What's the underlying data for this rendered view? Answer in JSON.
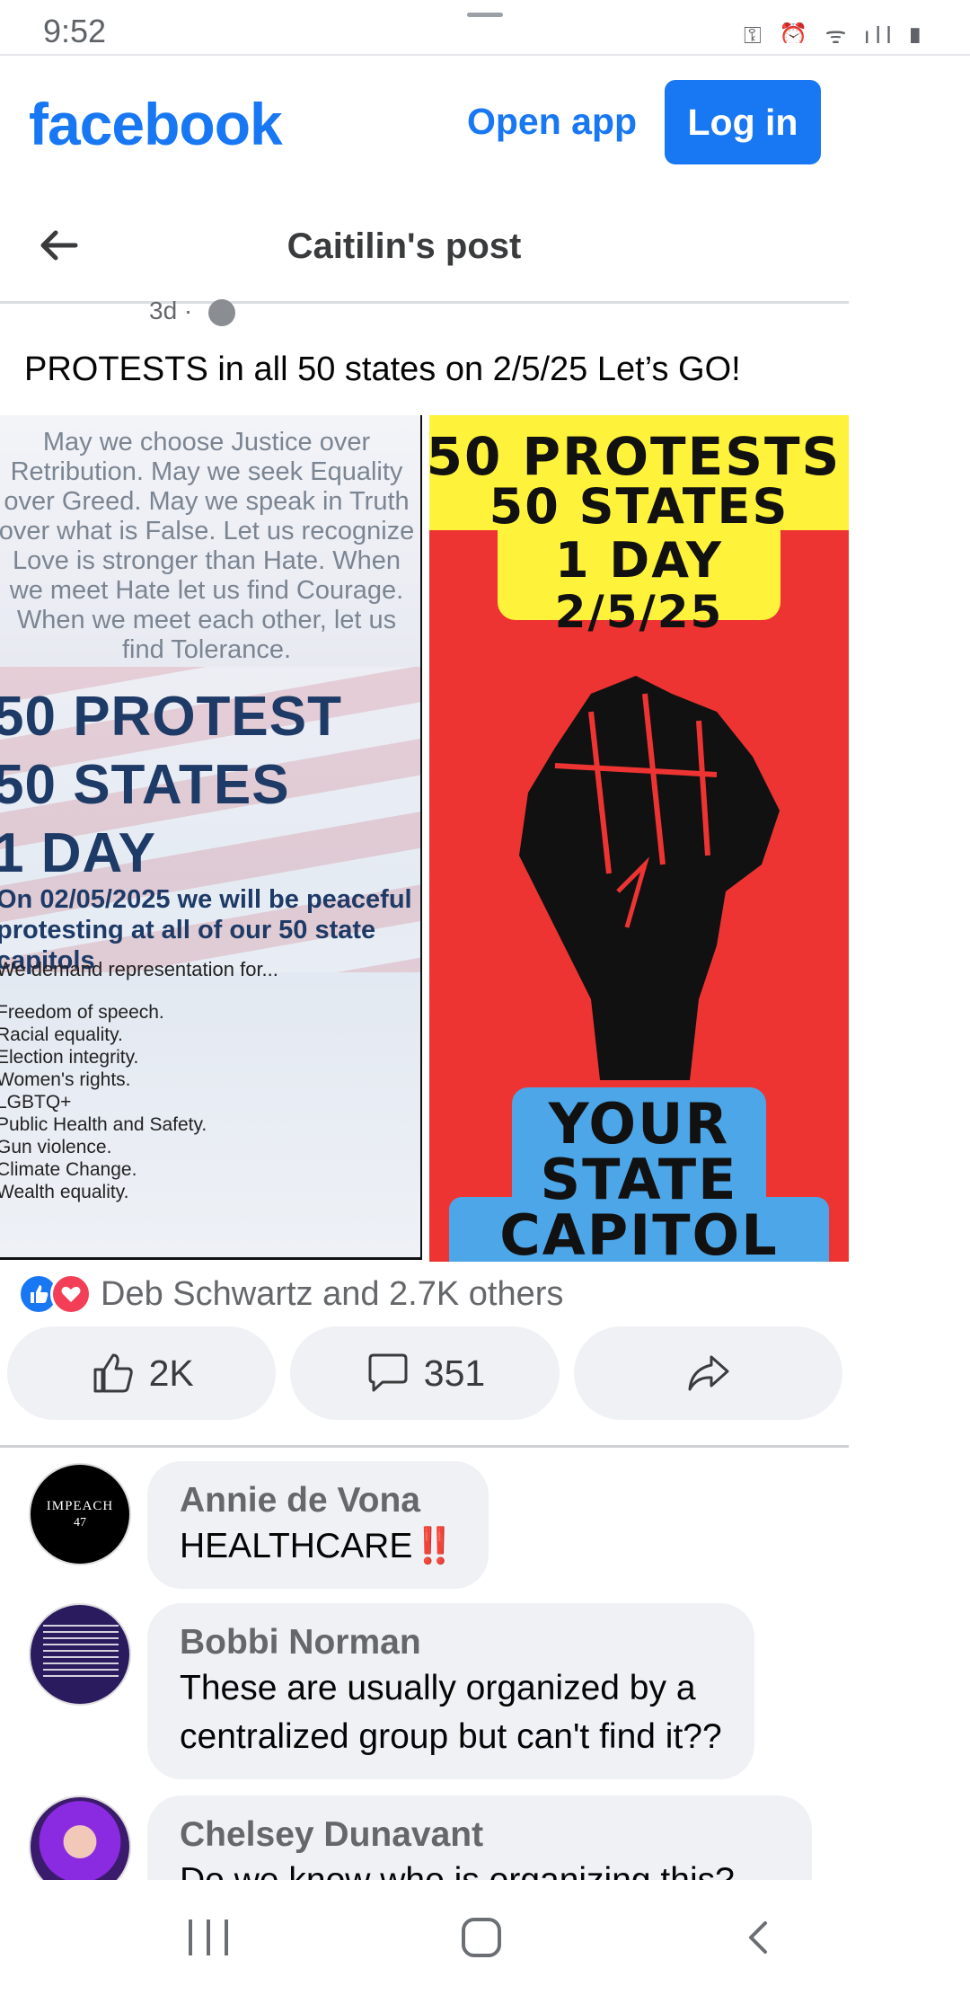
{
  "status_bar": {
    "time": "9:52",
    "icons": "⚿ ⏰ ᯤ ıll ▮"
  },
  "header": {
    "logo": "facebook",
    "open_app": "Open app",
    "login": "Log in"
  },
  "titlebar": {
    "title": "Caitilin's post"
  },
  "post": {
    "age": "3d ·",
    "text": "PROTESTS in all 50 states on 2/5/25 Let’s GO!",
    "image_left": {
      "quote": "May we choose Justice over\nRetribution. May we seek Equality\nover Greed. May we speak in Truth\nover what is False. Let us recognize\nLove is stronger than Hate. When\nwe meet Hate let us find Courage.\nWhen we meet each other, let us\nfind Tolerance.",
      "line1": "50 PROTEST",
      "line2": "50 STATES",
      "line3": "1 DAY",
      "sub": "On 02/05/2025 we will be peaceful\nprotesting at all of our 50 state capitols",
      "demand": "We demand representation for...",
      "demands": "Freedom of speech.\nRacial equality.\nElection integrity.\nWomen's rights.\nLGBTQ+\nPublic Health and Safety.\nGun violence.\nClimate Change.\nWealth equality."
    },
    "image_right": {
      "line1": "50 PROTESTS",
      "line2": "50 STATES",
      "line3": "1 DAY",
      "line4": "2/5/25",
      "line5": "YOUR",
      "line6": "STATE",
      "line7": "CAPITOL"
    },
    "reactions_text": "Deb Schwartz and 2.7K others",
    "likes": "2K",
    "comments": "351"
  },
  "comments": [
    {
      "name": "Annie de Vona",
      "text": "HEALTHCARE",
      "suffix": "‼️",
      "avatar_text1": "IMPEACH",
      "avatar_text2": "47"
    },
    {
      "name": "Bobbi Norman",
      "text": "These are usually organized  by a\ncentralized group but can't find it??"
    },
    {
      "name": "Chelsey Dunavant",
      "text": "Do we know who is organizing this?"
    }
  ],
  "colors": {
    "brand": "#1877f2",
    "poster_red": "#ee3433",
    "poster_yellow": "#fff23a",
    "poster_blue": "#4da6e8"
  }
}
